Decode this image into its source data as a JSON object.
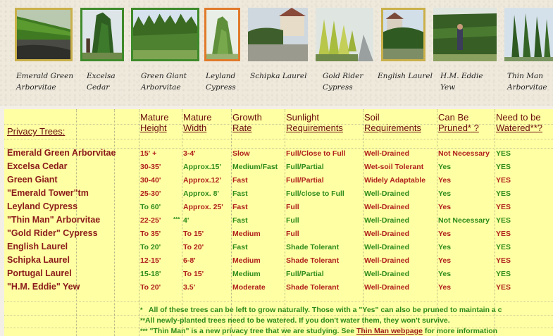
{
  "trees": [
    {
      "caption": "Emerald Green\nArborvitae",
      "icon": "emerald-green-arborvitae-photo"
    },
    {
      "caption": "Excelsa\nCedar",
      "icon": "excelsa-cedar-photo"
    },
    {
      "caption": "Green Giant\nArborvitae",
      "icon": "green-giant-arborvitae-photo"
    },
    {
      "caption": "Leyland\nCypress",
      "icon": "leyland-cypress-photo"
    },
    {
      "caption": "Schipka Laurel",
      "icon": "schipka-laurel-photo"
    },
    {
      "caption": "Gold Rider\nCypress",
      "icon": "gold-rider-cypress-photo"
    },
    {
      "caption": "English Laurel",
      "icon": "english-laurel-photo"
    },
    {
      "caption": "H.M. Eddie\nYew",
      "icon": "hm-eddie-yew-photo"
    },
    {
      "caption": "Thin Man\nArborvitae",
      "icon": "thin-man-arborvitae-photo"
    }
  ],
  "table": {
    "headers": [
      {
        "line1": "",
        "line2": "Privacy Trees:"
      },
      {
        "line1": "Mature",
        "line2": "Height"
      },
      {
        "line1": "Mature",
        "line2": "Width"
      },
      {
        "line1": "Growth",
        "line2": "Rate"
      },
      {
        "line1": "Sunlight",
        "line2": "Requirements"
      },
      {
        "line1": "Soil",
        "line2": "Requirements"
      },
      {
        "line1": "Can Be",
        "line2": "Pruned* ?"
      },
      {
        "line1": "Need to be",
        "line2": "Watered**?"
      }
    ],
    "rows": [
      [
        "Emerald Green Arborvitae",
        "15' +",
        "3-4'",
        "Slow",
        "Full/Close to Full",
        "Well-Drained",
        "Not Necessary",
        "YES"
      ],
      [
        "Excelsa Cedar",
        "30-35'",
        "Approx.15'",
        "Medium/Fast",
        "Full/Partial",
        "Wet-soil Tolerant",
        "Yes",
        "YES"
      ],
      [
        "Green Giant",
        "30-40'",
        "Approx.12'",
        "Fast",
        "Full/Partial",
        "Widely Adaptable",
        "Yes",
        "YES"
      ],
      [
        "\"Emerald Tower\"tm",
        "25-30'",
        "Approx. 8'",
        "Fast",
        "Full/close to Full",
        "Well-Drained",
        "Yes",
        "YES"
      ],
      [
        "Leyland Cypress",
        "To 60'",
        "Approx. 25'",
        "Fast",
        "Full",
        "Well-Drained",
        "Yes",
        "YES"
      ],
      [
        "\"Thin Man\" Arborvitae",
        "22-25'",
        "4'",
        "Fast",
        "Full",
        "Well-Drained",
        "Not Necessary",
        "YES"
      ],
      [
        "\"Gold Rider\" Cypress",
        "To 35'",
        "To 15'",
        "Medium",
        "Full",
        "Well-Drained",
        "Yes",
        "YES"
      ],
      [
        "English Laurel",
        "To 20'",
        "To 20'",
        "Fast",
        "Shade Tolerant",
        "Well-Drained",
        "Yes",
        "YES"
      ],
      [
        "Schipka Laurel",
        "12-15'",
        "6-8'",
        "Medium",
        "Shade Tolerant",
        "Well-Drained",
        "Yes",
        "YES"
      ],
      [
        "Portugal Laurel",
        "15-18'",
        "To 15'",
        "Medium",
        "Full/Partial",
        "Well-Drained",
        "Yes",
        "YES"
      ],
      [
        "\"H.M. Eddie\" Yew",
        "To 20'",
        "3.5'",
        "Moderate",
        "Shade Tolerant",
        "Well-Drained",
        "Yes",
        "YES"
      ]
    ],
    "thin_man_mark": "***"
  },
  "notes": {
    "n1_mark": "*",
    "n1": "All of these trees can be left to grow naturally.  Those with a \"Yes\" can also be pruned to maintain a c",
    "n2_mark": "**",
    "n2": "All newly-planted trees need to be watered.  If you don't water them, they won't survive.",
    "n3_mark": "***",
    "n3_pre": "\"Thin Man\" is a new privacy tree that we are studying.  See ",
    "n3_link": "Thin Man webpage",
    "n3_post": " for more information"
  },
  "colors": {
    "sheet_bg": "#ffffa3",
    "name_color": "#8b1a1a",
    "green": "#2e8b1c",
    "red": "#b0201c",
    "frame": "#c9b04a"
  }
}
